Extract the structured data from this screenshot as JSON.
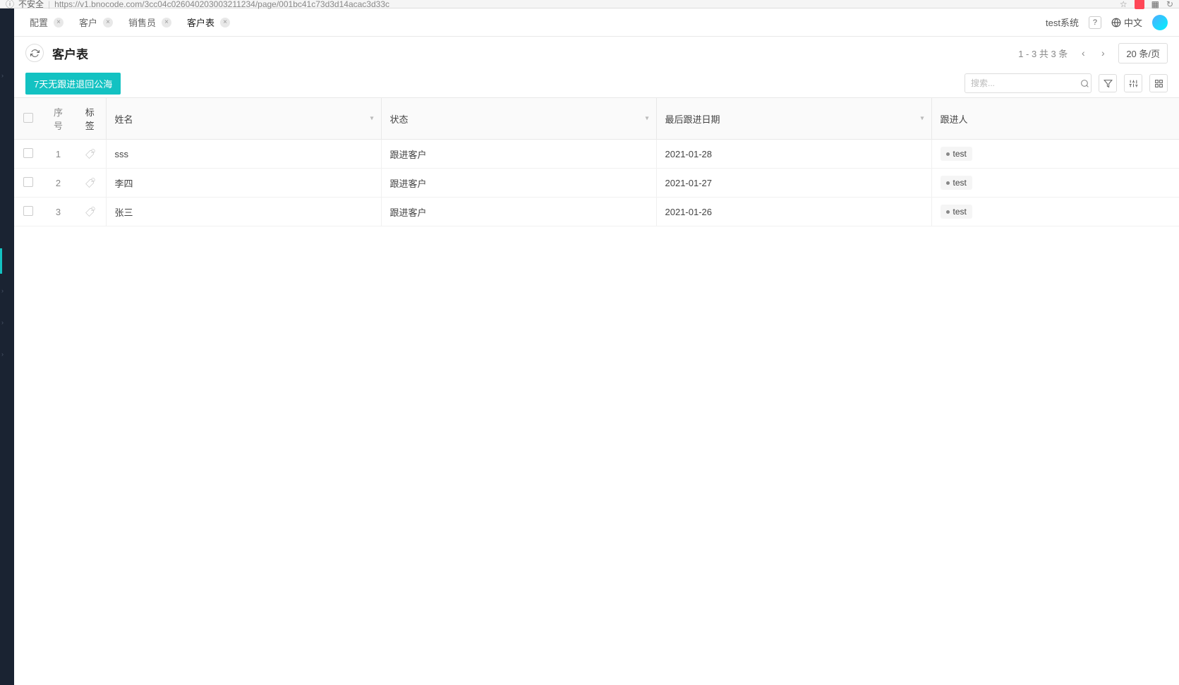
{
  "browser": {
    "security_label": "不安全",
    "url": "https://v1.bnocode.com/3cc04c026040203003211234/page/001bc41c73d3d14acac3d33c"
  },
  "tabs": [
    {
      "label": "配置",
      "active": false
    },
    {
      "label": "客户",
      "active": false
    },
    {
      "label": "销售员",
      "active": false
    },
    {
      "label": "客户表",
      "active": true
    }
  ],
  "header": {
    "system_name": "test系统",
    "language": "中文"
  },
  "page": {
    "title": "客户表",
    "action_button": "7天无跟进退回公海",
    "pagination_info": "1 - 3  共  3  条",
    "page_size": "20 条/页",
    "search_placeholder": "搜索..."
  },
  "table": {
    "headers": {
      "seq": "序号",
      "tag": "标签",
      "name": "姓名",
      "status": "状态",
      "date": "最后跟进日期",
      "assignee": "跟进人"
    },
    "rows": [
      {
        "seq": "1",
        "name": "sss",
        "status": "跟进客户",
        "date": "2021-01-28",
        "assignee": "test"
      },
      {
        "seq": "2",
        "name": "李四",
        "status": "跟进客户",
        "date": "2021-01-27",
        "assignee": "test"
      },
      {
        "seq": "3",
        "name": "张三",
        "status": "跟进客户",
        "date": "2021-01-26",
        "assignee": "test"
      }
    ]
  }
}
